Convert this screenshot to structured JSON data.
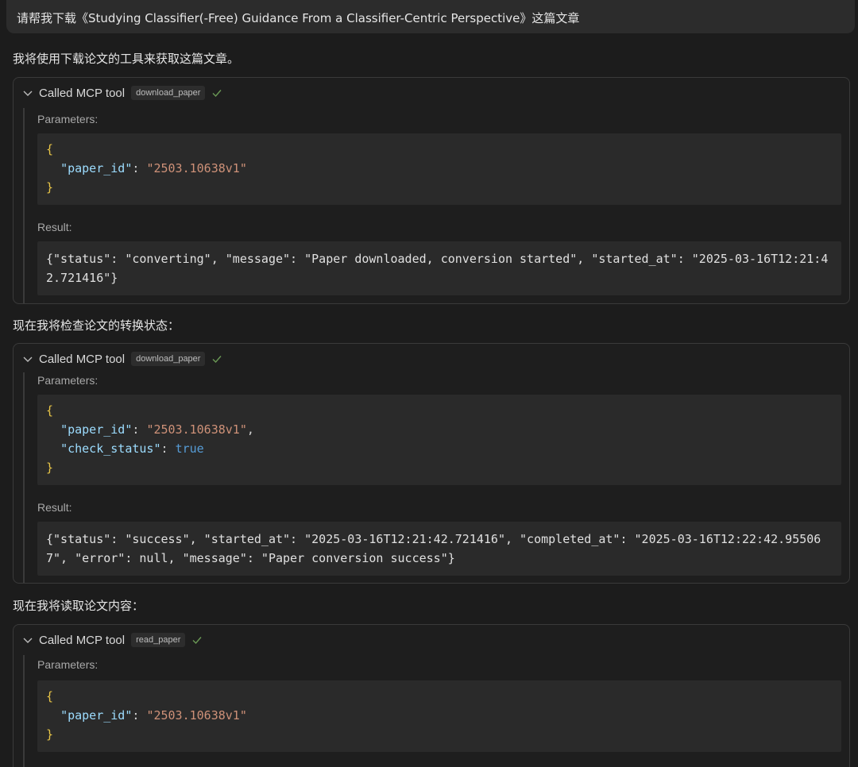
{
  "user_message": "请帮我下载《Studying Classifier(-Free) Guidance From a Classifier-Centric Perspective》这篇文章",
  "steps": [
    {
      "text": "我将使用下载论文的工具来获取这篇文章。",
      "tool": {
        "title": "Called MCP tool",
        "name": "download_paper",
        "params_label": "Parameters:",
        "params": {
          "open": "{",
          "lines": [
            {
              "key": "\"paper_id\"",
              "value": "\"2503.10638v1\"",
              "value_type": "string",
              "comma": ""
            }
          ],
          "close": "}"
        },
        "result_label": "Result:",
        "result": "{\"status\": \"converting\", \"message\": \"Paper downloaded, conversion started\", \"started_at\": \"2025-03-16T12:21:42.721416\"}"
      }
    },
    {
      "text": "现在我将检查论文的转换状态：",
      "tool": {
        "title": "Called MCP tool",
        "name": "download_paper",
        "params_label": "Parameters:",
        "params": {
          "open": "{",
          "lines": [
            {
              "key": "\"paper_id\"",
              "value": "\"2503.10638v1\"",
              "value_type": "string",
              "comma": ","
            },
            {
              "key": "\"check_status\"",
              "value": "true",
              "value_type": "keyword",
              "comma": ""
            }
          ],
          "close": "}"
        },
        "result_label": "Result:",
        "result": "{\"status\": \"success\", \"started_at\": \"2025-03-16T12:21:42.721416\", \"completed_at\": \"2025-03-16T12:22:42.955067\", \"error\": null, \"message\": \"Paper conversion success\"}"
      }
    },
    {
      "text": "现在我将读取论文内容：",
      "tool": {
        "title": "Called MCP tool",
        "name": "read_paper",
        "params_label": "Parameters:",
        "params": {
          "open": "{",
          "lines": [
            {
              "key": "\"paper_id\"",
              "value": "\"2503.10638v1\"",
              "value_type": "string",
              "comma": ""
            }
          ],
          "close": "}"
        }
      }
    }
  ],
  "colors": {
    "background": "#1c1c1c",
    "code_bg": "#2a2a2a",
    "json_key": "#9cdcfe",
    "json_string": "#ce9178",
    "json_brace": "#e8c547",
    "json_keyword": "#569cd6",
    "check": "#6a9955"
  }
}
